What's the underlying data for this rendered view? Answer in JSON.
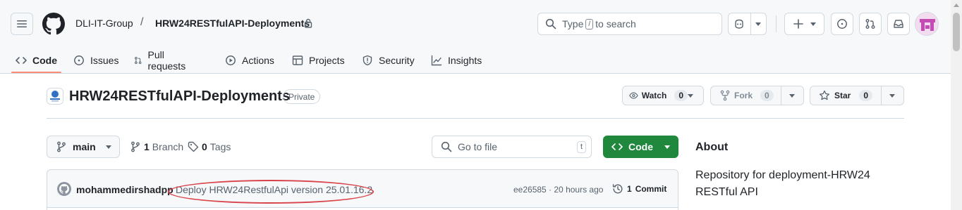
{
  "header": {
    "org": "DLI-IT-Group",
    "separator": "/",
    "repo": "HRW24RESTfulAPI-Deployments",
    "search": {
      "before": "Type",
      "key": "/",
      "after": "to search"
    }
  },
  "nav": {
    "tabs": [
      {
        "label": "Code",
        "icon": "code-icon",
        "active": true
      },
      {
        "label": "Issues",
        "icon": "issue-opened-icon"
      },
      {
        "label": "Pull requests",
        "icon": "git-pull-request-icon"
      },
      {
        "label": "Actions",
        "icon": "play-icon"
      },
      {
        "label": "Projects",
        "icon": "table-icon"
      },
      {
        "label": "Security",
        "icon": "shield-icon"
      },
      {
        "label": "Insights",
        "icon": "graph-icon"
      }
    ]
  },
  "repo": {
    "title": "HRW24RESTfulAPI-Deployments",
    "visibility": "Private",
    "watch": {
      "label": "Watch",
      "count": "0"
    },
    "fork": {
      "label": "Fork",
      "count": "0"
    },
    "star": {
      "label": "Star",
      "count": "0"
    }
  },
  "branch": {
    "current": "main",
    "branches_count": "1",
    "branches_label": "Branch",
    "tags_count": "0",
    "tags_label": "Tags",
    "file_search_placeholder": "Go to file",
    "file_search_key": "t",
    "code_button": "Code"
  },
  "commit": {
    "author": "mohammedirshadpp",
    "message": "Deploy HRW24RestfulApi version 25.01.16.2",
    "hash_time": "ee26585 · 20 hours ago",
    "commits_count": "1",
    "commits_label": "Commit"
  },
  "about": {
    "title": "About",
    "description": "Repository for deployment-HRW24 RESTful API"
  },
  "colors": {
    "accent_underline": "#fd8c73",
    "code_button_bg": "#1f883d",
    "annotation": "#d9434a"
  }
}
